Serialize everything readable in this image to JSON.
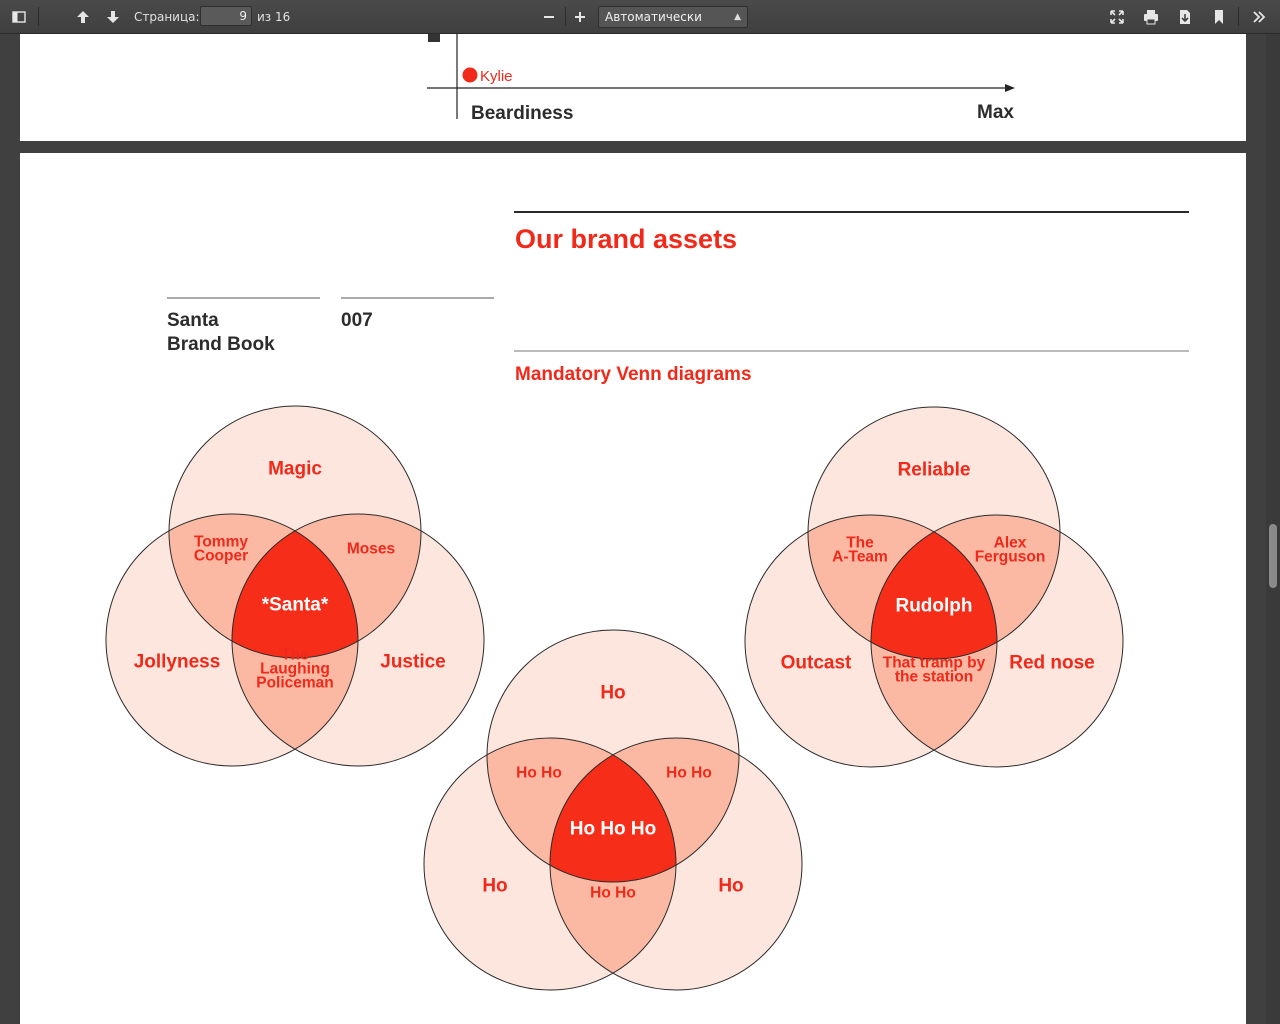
{
  "toolbar": {
    "page_label": "Страница:",
    "page_value": "9",
    "page_total": "из 16",
    "zoom_value": "Автоматически"
  },
  "prev_page": {
    "legend_kylie": "Kylie",
    "x_axis_label": "Beardiness",
    "x_axis_max": "Max"
  },
  "page": {
    "left_title": "Santa\nBrand Book",
    "page_number": "007",
    "heading": "Our brand assets",
    "subheading": "Mandatory Venn diagrams"
  },
  "venn_left": {
    "top": "Magic",
    "left": "Jollyness",
    "right": "Justice",
    "top_left": "Tommy\nCooper",
    "top_right": "Moses",
    "bottom": "The\nLaughing\nPoliceman",
    "center": "*Santa*"
  },
  "venn_right": {
    "top": "Reliable",
    "left": "Outcast",
    "right": "Red nose",
    "top_left": "The\nA-Team",
    "top_right": "Alex\nFerguson",
    "bottom": "That tramp by\nthe station",
    "center": "Rudolph"
  },
  "venn_middle": {
    "top": "Ho",
    "left": "Ho",
    "right": "Ho",
    "top_left": "Ho Ho",
    "top_right": "Ho Ho",
    "bottom": "Ho Ho",
    "center": "Ho Ho Ho"
  },
  "colors": {
    "accent": "#f0291a",
    "circle_fill": "#fce6de",
    "pair_fill": "#fbb9a4",
    "center_fill": "#f52d19"
  }
}
